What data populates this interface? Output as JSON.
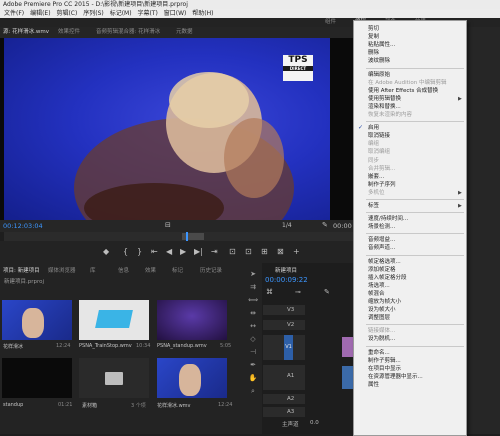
{
  "window": {
    "title": "Adobe Premiere Pro CC 2015 - D:\\影视\\新建项目\\新建项目.prproj"
  },
  "menubar": [
    "文件(F)",
    "编辑(E)",
    "剪辑(C)",
    "序列(S)",
    "标记(M)",
    "字幕(T)",
    "窗口(W)",
    "帮助(H)"
  ],
  "workspaces": [
    "组件",
    "编辑",
    "颜色",
    "效果"
  ],
  "monitor": {
    "tabs": [
      "源: 花样滑冰.wmv",
      "效果控件",
      "音频剪辑混合器: 花样滑冰",
      "元数据"
    ],
    "logo_top": "TPS",
    "logo_bottom": "DIRECT",
    "timecode": "00:12:03:04",
    "fit": "1/4",
    "timecode_right": "00:00"
  },
  "transport": [
    "◆",
    "{",
    "}",
    "⇤",
    "◀",
    "▶",
    "▶|",
    "⇥",
    "⊡",
    "⊡",
    "⊞",
    "⊠",
    "+"
  ],
  "project": {
    "tabs": [
      "项目: 新建项目",
      "媒体浏览器",
      "库",
      "信息",
      "效果",
      "标记",
      "历史记录"
    ],
    "path": "新建项目.prproj",
    "items": [
      {
        "name": "花样滑冰",
        "duration": "12:24"
      },
      {
        "name": "PSNA_TrainStop.wmv",
        "duration": "10:34"
      },
      {
        "name": "PSNA_standup.wmv",
        "duration": "5:05"
      },
      {
        "name": "standup",
        "duration": "01:21"
      },
      {
        "name": "素材箱",
        "duration": "3 个项"
      },
      {
        "name": "花样滑冰.wmv",
        "duration": "12:24"
      }
    ]
  },
  "timeline": {
    "tab": "新建项目",
    "timecode": "00:00:09:22",
    "tracks": [
      "V3",
      "V2",
      "V1",
      "A1",
      "A2",
      "A3",
      "主声道"
    ],
    "master_value": "0.0"
  },
  "context_menu": {
    "items": [
      {
        "label": "剪切",
        "state": "normal"
      },
      {
        "label": "复制",
        "state": "normal"
      },
      {
        "label": "粘贴属性...",
        "state": "normal"
      },
      {
        "label": "删除",
        "state": "normal"
      },
      {
        "label": "波纹删除",
        "state": "normal"
      },
      {
        "label": "sep"
      },
      {
        "label": "编辑原始",
        "state": "normal"
      },
      {
        "label": "在 Adobe Audition 中编辑剪辑",
        "state": "disabled"
      },
      {
        "label": "使用 After Effects 合成替换",
        "state": "normal"
      },
      {
        "label": "使用剪辑替换",
        "state": "normal",
        "submenu": true
      },
      {
        "label": "渲染和替换...",
        "state": "normal"
      },
      {
        "label": "恢复未渲染的内容",
        "state": "disabled"
      },
      {
        "label": "sep"
      },
      {
        "label": "启用",
        "state": "checked"
      },
      {
        "label": "取消链接",
        "state": "normal"
      },
      {
        "label": "编组",
        "state": "disabled"
      },
      {
        "label": "取消编组",
        "state": "disabled"
      },
      {
        "label": "同步",
        "state": "disabled"
      },
      {
        "label": "合并剪辑...",
        "state": "disabled"
      },
      {
        "label": "嵌套...",
        "state": "normal"
      },
      {
        "label": "制作子序列",
        "state": "normal"
      },
      {
        "label": "多机位",
        "state": "disabled",
        "submenu": true
      },
      {
        "label": "sep"
      },
      {
        "label": "标签",
        "state": "normal",
        "submenu": true
      },
      {
        "label": "sep"
      },
      {
        "label": "速度/持续时间...",
        "state": "normal"
      },
      {
        "label": "场景检测...",
        "state": "normal"
      },
      {
        "label": "sep"
      },
      {
        "label": "音频增益...",
        "state": "normal"
      },
      {
        "label": "音频声道...",
        "state": "normal"
      },
      {
        "label": "sep"
      },
      {
        "label": "帧定格选项...",
        "state": "normal"
      },
      {
        "label": "添加帧定格",
        "state": "normal"
      },
      {
        "label": "插入帧定格分段",
        "state": "normal"
      },
      {
        "label": "场选项...",
        "state": "normal"
      },
      {
        "label": "帧混合",
        "state": "normal"
      },
      {
        "label": "缩放为帧大小",
        "state": "normal"
      },
      {
        "label": "设为帧大小",
        "state": "normal"
      },
      {
        "label": "调整图层",
        "state": "normal"
      },
      {
        "label": "sep"
      },
      {
        "label": "链接媒体...",
        "state": "disabled"
      },
      {
        "label": "设为脱机...",
        "state": "normal"
      },
      {
        "label": "sep"
      },
      {
        "label": "重命名...",
        "state": "normal"
      },
      {
        "label": "制作子剪辑...",
        "state": "normal"
      },
      {
        "label": "在项目中显示",
        "state": "normal"
      },
      {
        "label": "在资源管理器中显示...",
        "state": "normal"
      },
      {
        "label": "属性",
        "state": "normal"
      }
    ]
  }
}
